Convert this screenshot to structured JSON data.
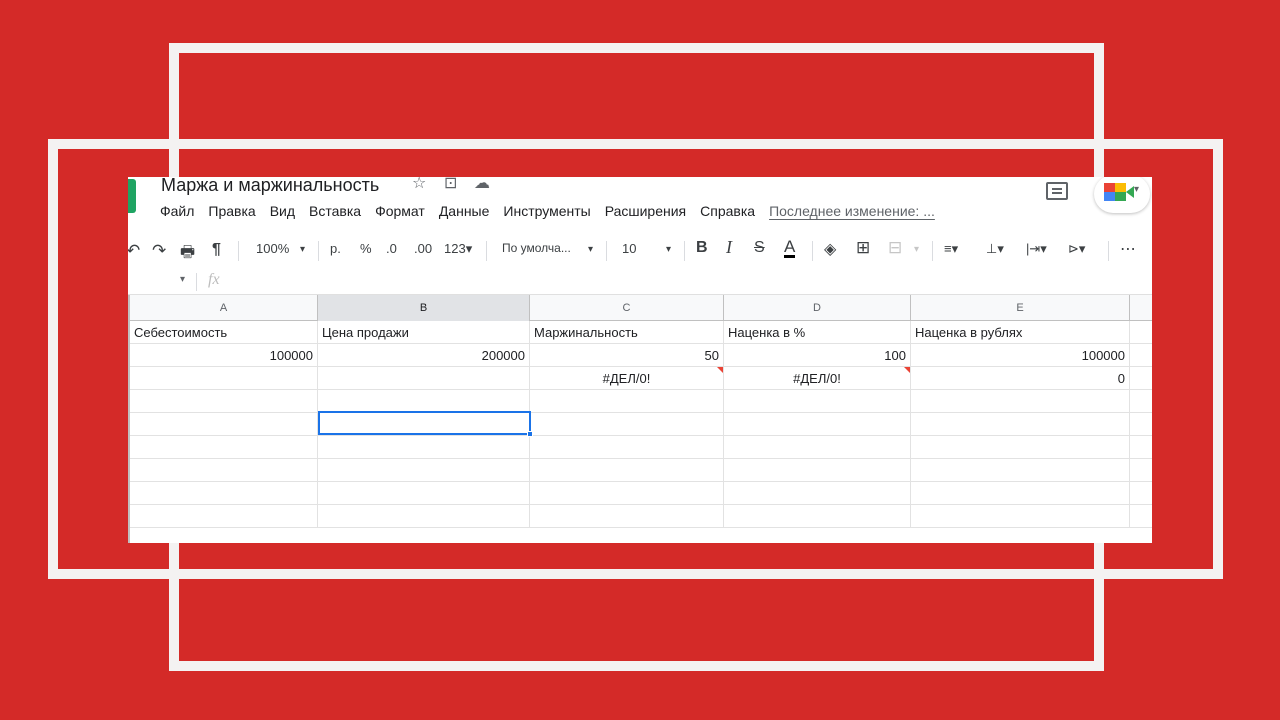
{
  "doc": {
    "title": "Маржа и маржинальность",
    "star_icon": "☆",
    "move_icon": "⊡",
    "cloud_icon": "☁"
  },
  "menu": {
    "items": [
      "Файл",
      "Правка",
      "Вид",
      "Вставка",
      "Формат",
      "Данные",
      "Инструменты",
      "Расширения",
      "Справка"
    ],
    "last_edit": "Последнее изменение: ..."
  },
  "toolbar": {
    "undo": "↶",
    "redo": "↷",
    "print": "🖶",
    "paint": "¶",
    "zoom": "100%",
    "zoom_caret": "▾",
    "currency": "р.",
    "percent": "%",
    "dec_less": ".0",
    "dec_more": ".00",
    "more_formats": "123▾",
    "font": "По умолча...",
    "font_caret": "▾",
    "font_size": "10",
    "size_caret": "▾",
    "bold": "B",
    "italic": "I",
    "strike": "S",
    "text_color": "A",
    "fill": "◈",
    "borders": "⊞",
    "merge": "⊟",
    "merge_caret": "▾",
    "halign": "≡▾",
    "valign": "⊥▾",
    "wrap": "|⇥▾",
    "rotate": "⊳▾",
    "more": "⋯"
  },
  "formula_bar": {
    "caret": "▾",
    "fx": "fx"
  },
  "sheet": {
    "columns": [
      "A",
      "B",
      "C",
      "D",
      "E"
    ],
    "rows": [
      [
        {
          "v": "Себестоимость",
          "align": "left"
        },
        {
          "v": "Цена продажи",
          "align": "left"
        },
        {
          "v": "Маржинальность",
          "align": "left"
        },
        {
          "v": "Наценка в %",
          "align": "left"
        },
        {
          "v": "Наценка в рублях",
          "align": "left"
        }
      ],
      [
        {
          "v": "100000",
          "align": "right"
        },
        {
          "v": "200000",
          "align": "right"
        },
        {
          "v": "50",
          "align": "right"
        },
        {
          "v": "100",
          "align": "right"
        },
        {
          "v": "100000",
          "align": "right"
        }
      ],
      [
        {
          "v": "",
          "align": "left"
        },
        {
          "v": "",
          "align": "left"
        },
        {
          "v": "#ДЕЛ/0!",
          "align": "center",
          "error": true
        },
        {
          "v": "#ДЕЛ/0!",
          "align": "center",
          "error": true
        },
        {
          "v": "0",
          "align": "right"
        }
      ],
      [
        {
          "v": ""
        },
        {
          "v": ""
        },
        {
          "v": ""
        },
        {
          "v": ""
        },
        {
          "v": ""
        }
      ],
      [
        {
          "v": ""
        },
        {
          "v": ""
        },
        {
          "v": ""
        },
        {
          "v": ""
        },
        {
          "v": ""
        }
      ],
      [
        {
          "v": ""
        },
        {
          "v": ""
        },
        {
          "v": ""
        },
        {
          "v": ""
        },
        {
          "v": ""
        }
      ],
      [
        {
          "v": ""
        },
        {
          "v": ""
        },
        {
          "v": ""
        },
        {
          "v": ""
        },
        {
          "v": ""
        }
      ],
      [
        {
          "v": ""
        },
        {
          "v": ""
        },
        {
          "v": ""
        },
        {
          "v": ""
        },
        {
          "v": ""
        }
      ],
      [
        {
          "v": ""
        },
        {
          "v": ""
        },
        {
          "v": ""
        },
        {
          "v": ""
        },
        {
          "v": ""
        }
      ]
    ],
    "selected_cell": "B5",
    "selected_column": "B"
  },
  "colors": {
    "background": "#d42a28",
    "frame": "#f4f2f2",
    "selection": "#1a73e8",
    "error_marker": "#ea4335"
  }
}
